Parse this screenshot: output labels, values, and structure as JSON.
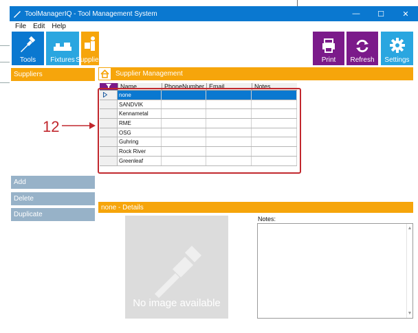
{
  "window": {
    "title": "ToolManagerIQ - Tool Management System",
    "minimize": "—",
    "maximize": "☐",
    "close": "✕"
  },
  "menu": [
    "File",
    "Edit",
    "Help"
  ],
  "tiles": {
    "tools": "Tools",
    "fixtures": "Fixtures",
    "suppliers": "Suppliers",
    "print": "Print",
    "refresh": "Refresh",
    "settings": "Settings"
  },
  "sidebar": {
    "section": "Suppliers",
    "add": "Add",
    "delete": "Delete",
    "duplicate": "Duplicate"
  },
  "main": {
    "header": "Supplier Management"
  },
  "grid": {
    "columns": [
      "Name",
      "PhoneNumber",
      "Email",
      "Notes"
    ],
    "rows": [
      "none",
      "SANDVIK",
      "Kennametal",
      "RME",
      "OSG",
      "Guhring",
      "Rock River",
      "Greenleaf"
    ],
    "selected_index": 0
  },
  "annotation": {
    "number": "12"
  },
  "details": {
    "header": "none - Details",
    "no_image": "No image available",
    "notes_label": "Notes:"
  },
  "colors": {
    "orange": "#f6a50b",
    "blue": "#0a78d0",
    "purple": "#7b1a8a",
    "sky": "#2aa6e0",
    "slate": "#97b2c8",
    "red": "#c1272d"
  }
}
